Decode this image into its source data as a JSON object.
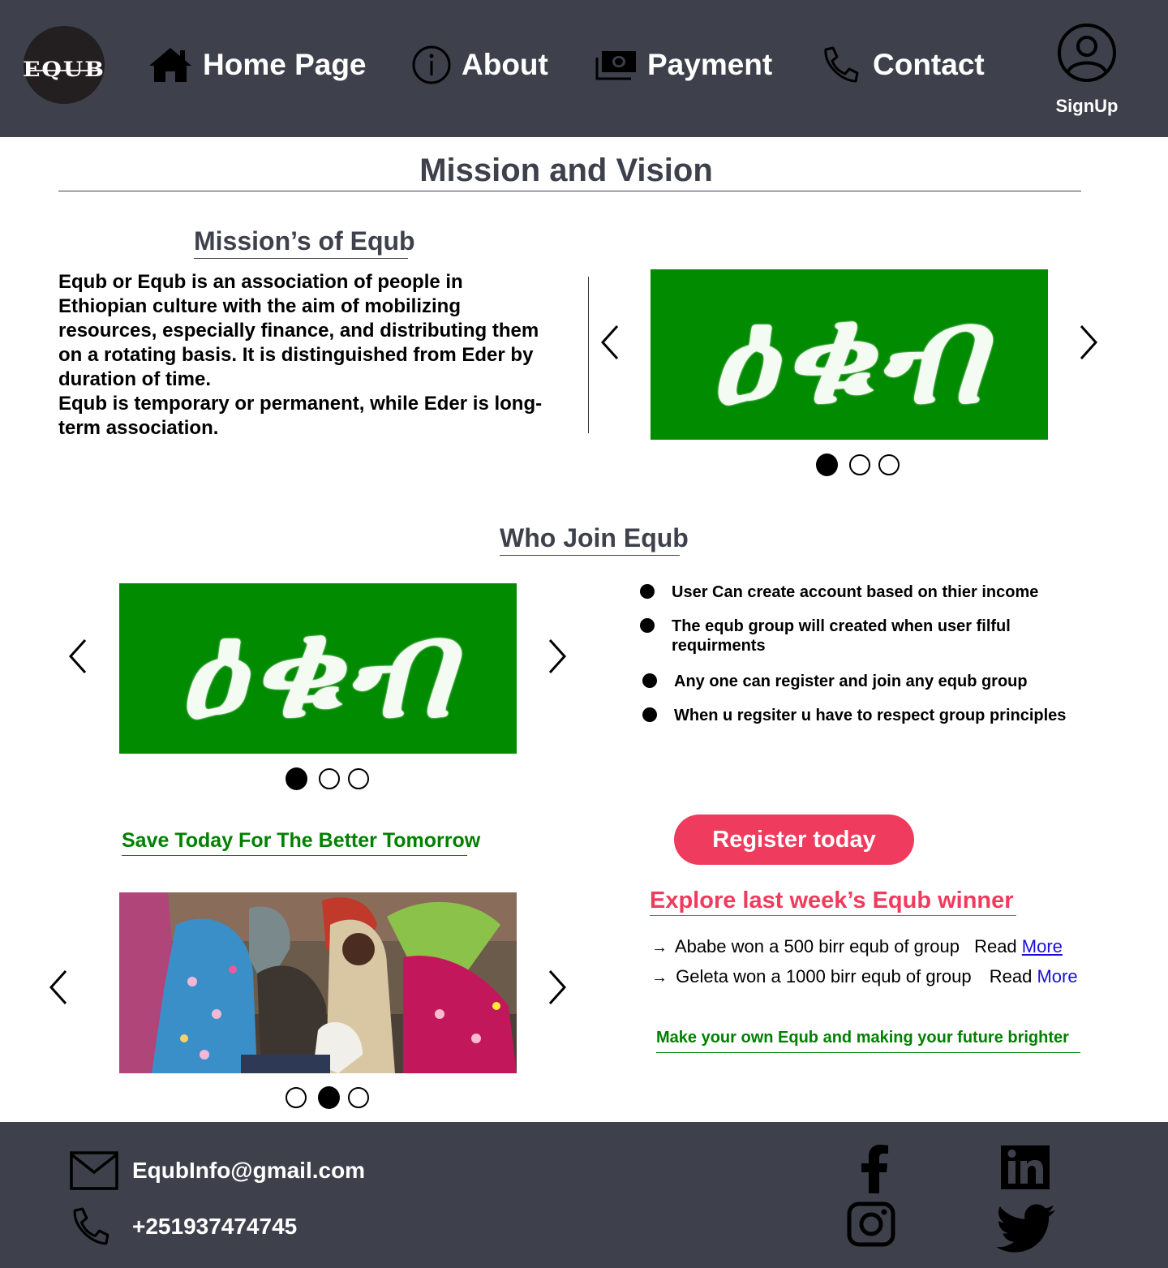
{
  "header": {
    "logo_text": "EQUB",
    "nav": [
      {
        "label": "Home Page",
        "icon": "home-icon"
      },
      {
        "label": "About",
        "icon": "info-icon"
      },
      {
        "label": "Payment",
        "icon": "money-icon"
      },
      {
        "label": "Contact",
        "icon": "phone-icon"
      }
    ],
    "signup_label": "SignUp",
    "signup_icon": "user-circle-icon"
  },
  "page_title": "Mission and Vision",
  "mission": {
    "title": "Mission’s of Equb",
    "paragraph_1": "Equb or Equb is an association of people in Ethiopian culture with the aim of mobilizing resources, especially finance, and distributing them on a rotating  basis. It is distinguished from Eder by duration of time.",
    "paragraph_2": "Equb is temporary or permanent, while Eder is long-term association.",
    "carousel": {
      "image_text": "ዕቁብ",
      "active_slide": 1,
      "slide_count": 3
    }
  },
  "who_join": {
    "title": "Who Join Equb",
    "carousel": {
      "image_text": "ዕቁብ",
      "active_slide": 1,
      "slide_count": 3
    },
    "bullets": [
      "User Can create account based on thier income",
      "The equb group will created when user filful requirments",
      "Any one can register and join any equb group",
      "When u regsiter u have to respect group principles"
    ]
  },
  "save": {
    "heading": "Save Today For The Better Tomorrow",
    "photo_carousel": {
      "active_slide": 2,
      "slide_count": 3,
      "alt": "market-photo"
    }
  },
  "cta": {
    "register_label": "Register today",
    "winners_heading": "Explore last week’s Equb winner",
    "winners": [
      {
        "text": "Ababe won a 500 birr equb of group",
        "read": "Read",
        "more": "More"
      },
      {
        "text": "Geleta won a 1000 birr equb of group",
        "read": "Read",
        "more": "More"
      }
    ],
    "tagline": "Make your own Equb  and  making your future brighter"
  },
  "footer": {
    "email": "EqubInfo@gmail.com",
    "phone": "+251937474745",
    "social": [
      "facebook-icon",
      "linkedin-icon",
      "instagram-icon",
      "twitter-icon"
    ]
  },
  "colors": {
    "header_bg": "#3e414b",
    "accent_red": "#ef3b5d",
    "brand_green": "#008b00",
    "text_green": "#008000",
    "link_blue": "#1a10d6"
  }
}
